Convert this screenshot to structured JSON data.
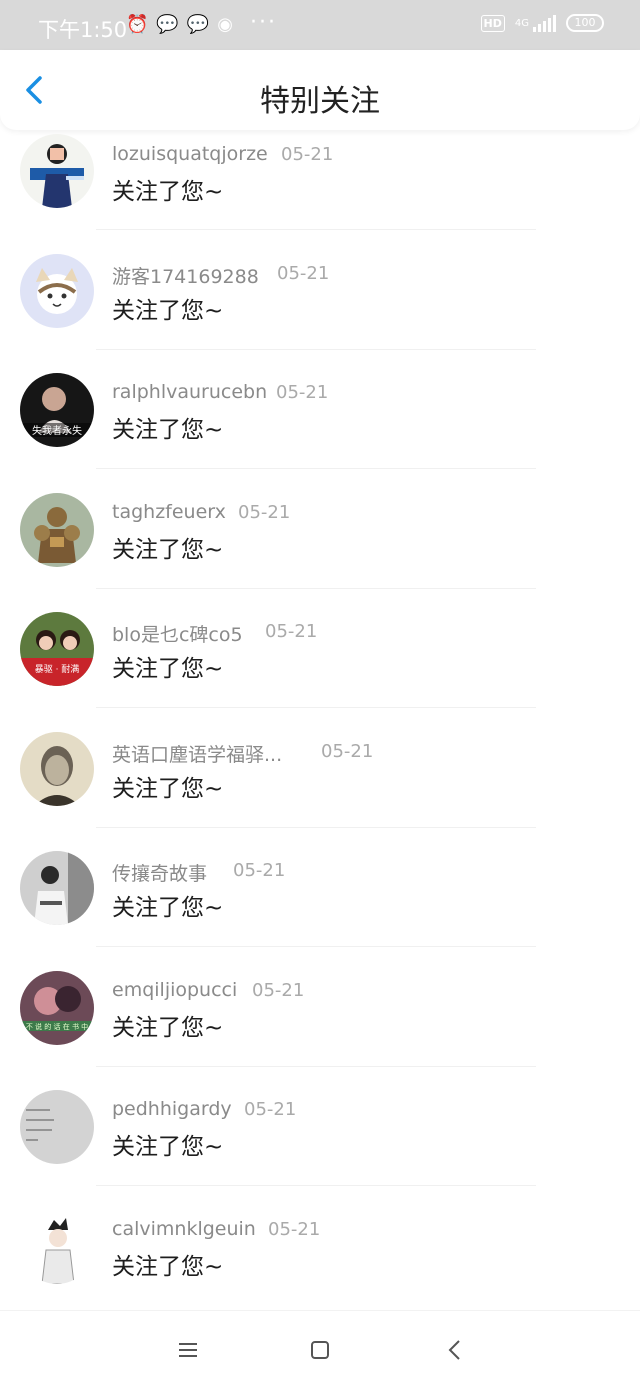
{
  "status": {
    "time": "下午1:50",
    "icons": [
      "alarm-icon",
      "wechat-icon",
      "wechat-icon",
      "app-icon"
    ],
    "more": "···",
    "hd": "HD",
    "network": "4G",
    "battery": "100"
  },
  "header": {
    "title": "特别关注",
    "back_icon": "chevron-left-icon"
  },
  "list": {
    "items": [
      {
        "name": "lozuisquatqjorze",
        "date": "05-21",
        "message": "关注了您~"
      },
      {
        "name": "游客174169288",
        "date": "05-21",
        "message": "关注了您~"
      },
      {
        "name": "ralphlvaurucebn",
        "date": "05-21",
        "message": "关注了您~"
      },
      {
        "name": "taghzfeuerx",
        "date": "05-21",
        "message": "关注了您~"
      },
      {
        "name": "blo是乜c碑co5",
        "date": "05-21",
        "message": "关注了您~"
      },
      {
        "name": "英语口塵语学福驿...",
        "date": "05-21",
        "message": "关注了您~"
      },
      {
        "name": "传攘奇故事",
        "date": "05-21",
        "message": "关注了您~"
      },
      {
        "name": "emqiljiopucci",
        "date": "05-21",
        "message": "关注了您~"
      },
      {
        "name": "pedhhigardy",
        "date": "05-21",
        "message": "关注了您~"
      },
      {
        "name": "calvimnklgeuin",
        "date": "05-21",
        "message": "关注了您~"
      }
    ]
  },
  "nav": {
    "menu_icon": "menu-icon",
    "home_icon": "square-home-icon",
    "back_icon": "back-triangle-icon"
  },
  "colors": {
    "accent": "#1a8fe3",
    "status_bar": "#d9d9d9"
  }
}
